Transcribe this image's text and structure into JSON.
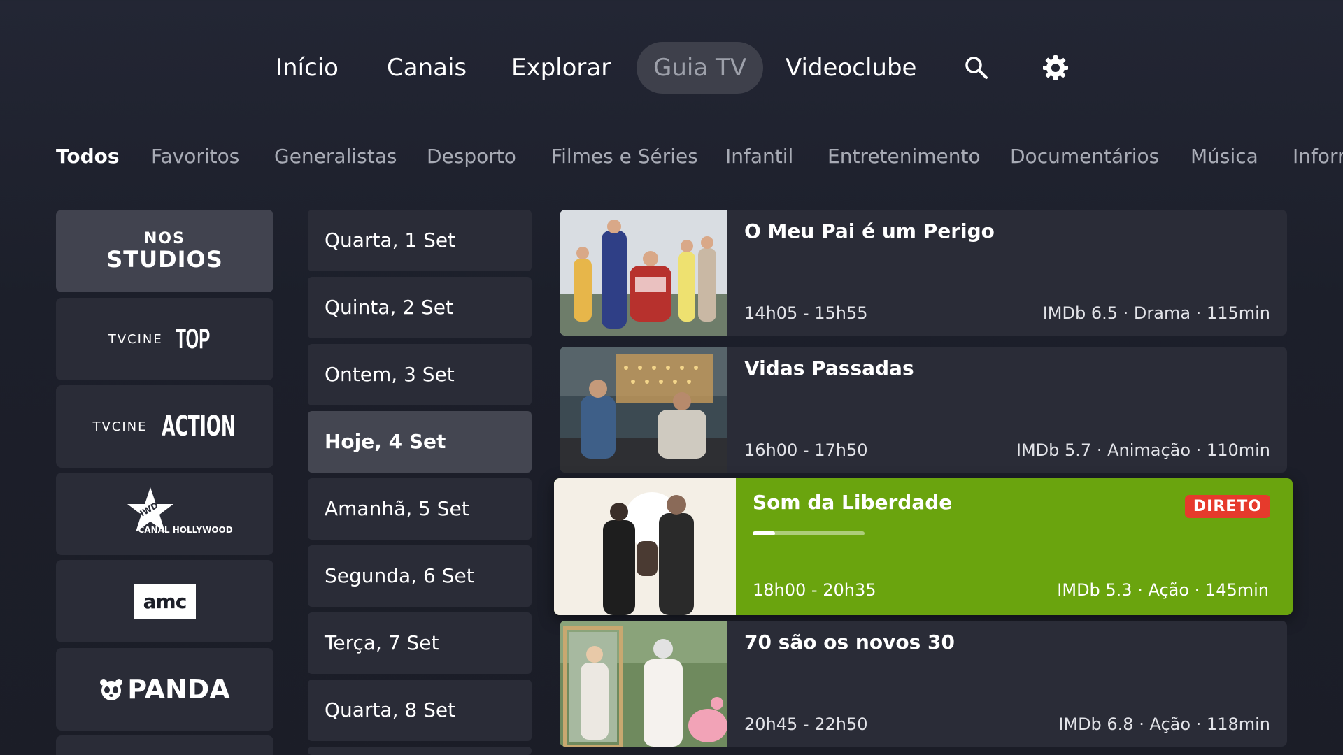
{
  "nav": {
    "items": [
      {
        "label": "Início",
        "active": false
      },
      {
        "label": "Canais",
        "active": false
      },
      {
        "label": "Explorar",
        "active": false
      },
      {
        "label": "Guia TV",
        "active": true
      },
      {
        "label": "Videoclube",
        "active": false
      }
    ],
    "icons": [
      "search-icon",
      "gear-icon"
    ]
  },
  "categories": [
    {
      "label": "Todos",
      "active": true
    },
    {
      "label": "Favoritos"
    },
    {
      "label": "Generalistas"
    },
    {
      "label": "Desporto"
    },
    {
      "label": "Filmes e Séries"
    },
    {
      "label": "Infantil"
    },
    {
      "label": "Entretenimento"
    },
    {
      "label": "Documentários"
    },
    {
      "label": "Música"
    },
    {
      "label": "Inforr"
    }
  ],
  "channels": [
    {
      "name": "NOS STUDIOS",
      "logo_text_top": "NOS",
      "logo_text_bottom": "STUDIOS",
      "active": true
    },
    {
      "name": "TVCINE TOP",
      "logo_text_small": "TVCINE",
      "logo_text_big": "TOP"
    },
    {
      "name": "TVCINE ACTION",
      "logo_text_small": "TVCINE",
      "logo_text_big": "ACTION"
    },
    {
      "name": "CANAL HOLLYWOOD",
      "logo_text_small": "HWD",
      "logo_text_big": "CANAL HOLLYWOOD"
    },
    {
      "name": "AMC",
      "logo_text": "amc"
    },
    {
      "name": "PANDA",
      "logo_text": "PANDA"
    }
  ],
  "dates": [
    {
      "label": "Quarta, 1 Set"
    },
    {
      "label": "Quinta, 2 Set"
    },
    {
      "label": "Ontem, 3 Set"
    },
    {
      "label": "Hoje, 4 Set",
      "active": true
    },
    {
      "label": "Amanhã, 5 Set"
    },
    {
      "label": "Segunda, 6 Set"
    },
    {
      "label": "Terça, 7 Set"
    },
    {
      "label": "Quarta, 8 Set"
    }
  ],
  "programs": [
    {
      "title": "O Meu Pai é um Perigo",
      "time": "14h05 - 15h55",
      "meta": "IMDb 6.5 · Drama · 115min",
      "live": false
    },
    {
      "title": "Vidas Passadas",
      "time": "16h00 - 17h50",
      "meta": "IMDb 5.7 · Animação · 110min",
      "live": false
    },
    {
      "title": "Som da Liberdade",
      "time": "18h00 - 20h35",
      "meta": "IMDb 5.3 · Ação · 145min",
      "live": true,
      "badge": "DIRETO",
      "progress": 0.2
    },
    {
      "title": "70 são os novos 30",
      "time": "20h45 - 22h50",
      "meta": "IMDb 6.8 · Ação · 118min",
      "live": false
    }
  ],
  "colors": {
    "background": "#1e212c",
    "card": "#2a2c37",
    "live_accent": "#6aa40e",
    "live_badge": "#e63a2c",
    "active_nav_pill": "#3e404b"
  }
}
